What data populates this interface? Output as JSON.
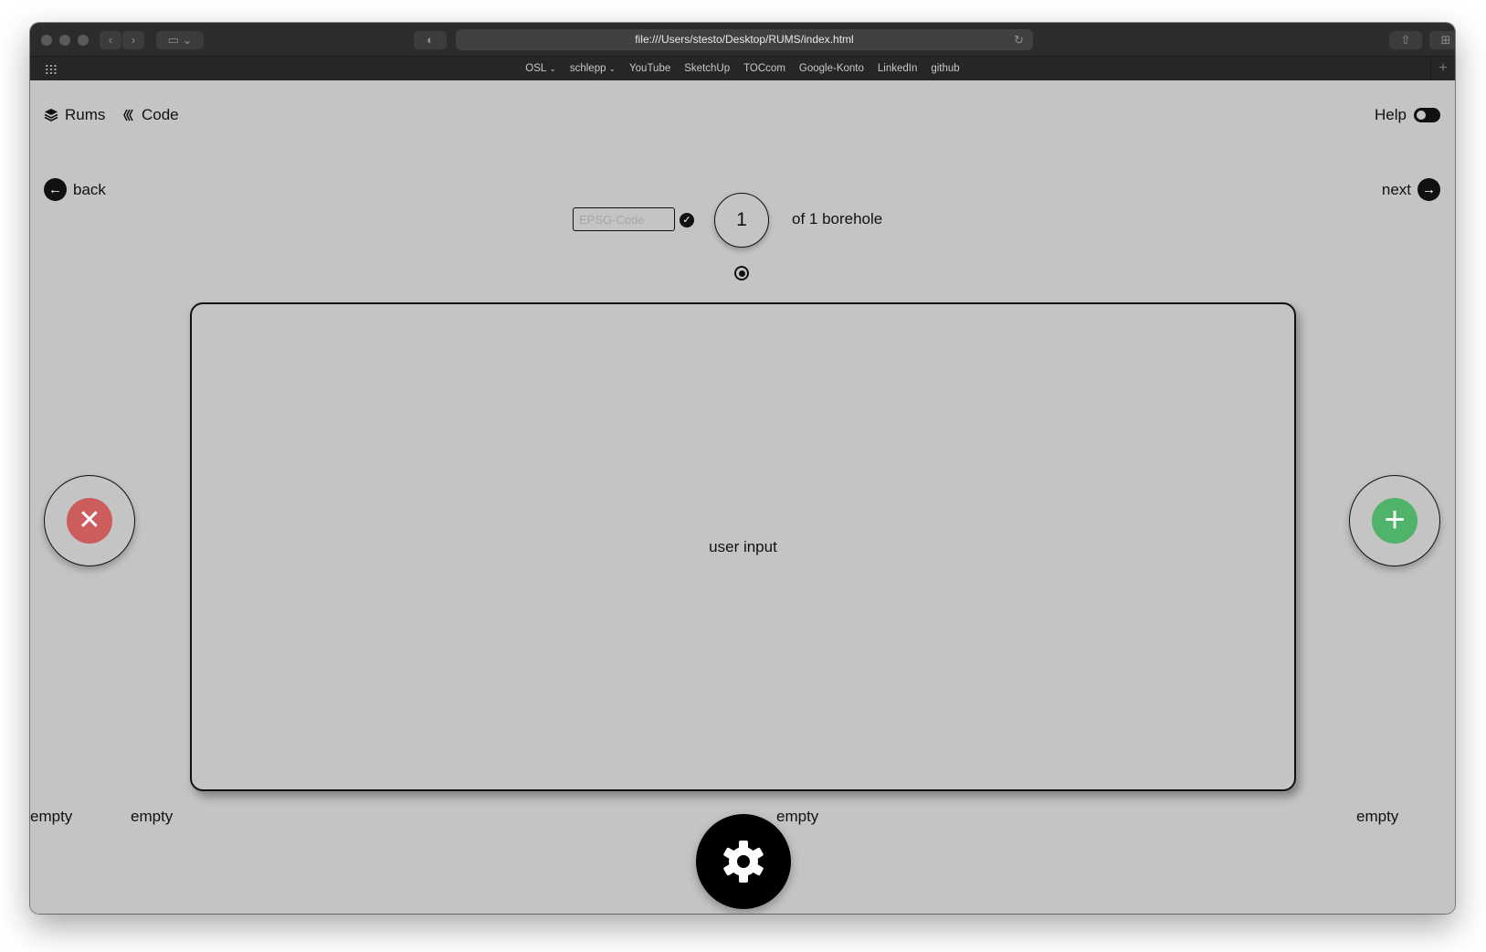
{
  "browser": {
    "url": "file:///Users/stesto/Desktop/RUMS/index.html",
    "favorites": [
      {
        "label": "OSL",
        "has_menu": true
      },
      {
        "label": "schlepp",
        "has_menu": true
      },
      {
        "label": "YouTube",
        "has_menu": false
      },
      {
        "label": "SketchUp",
        "has_menu": false
      },
      {
        "label": "TOCcom",
        "has_menu": false
      },
      {
        "label": "Google-Konto",
        "has_menu": false
      },
      {
        "label": "LinkedIn",
        "has_menu": false
      },
      {
        "label": "github",
        "has_menu": false
      }
    ]
  },
  "header": {
    "brand_label": "Rums",
    "code_label": "Code",
    "help_label": "Help",
    "help_enabled": false
  },
  "navigation": {
    "back_label": "back",
    "next_label": "next",
    "epsg_placeholder": "EPSG-Code",
    "current_index": "1",
    "total_text": "of 1 borehole"
  },
  "main": {
    "card_text": "user input"
  },
  "slots": {
    "left_1": "empty",
    "left_2": "empty",
    "center": "empty",
    "right": "empty"
  },
  "colors": {
    "page_background": "#c4c4c4",
    "remove_button": "#cd5c5c",
    "add_button": "#4fb36a",
    "dark": "#111111"
  },
  "icons": {
    "brand": "layers-icon",
    "code": "code-icon",
    "back": "arrow-left-icon",
    "next": "arrow-right-icon",
    "confirm": "check-icon",
    "remove": "close-icon",
    "add": "plus-icon",
    "settings": "gear-icon"
  }
}
